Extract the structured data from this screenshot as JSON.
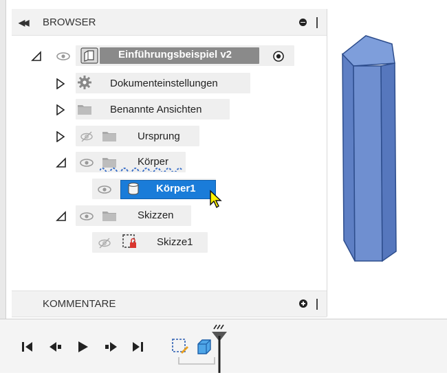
{
  "browser": {
    "title": "BROWSER",
    "collapse_icon": "double-chevron-left-icon",
    "options_icon": "minus-circle-icon",
    "root": {
      "label": "Einführungsbeispiel v2"
    },
    "items": [
      {
        "label": "Dokumenteinstellungen",
        "icon": "gear-icon"
      },
      {
        "label": "Benannte Ansichten",
        "icon": "folder-icon"
      },
      {
        "label": "Ursprung",
        "icon": "folder-icon"
      },
      {
        "label": "Körper",
        "icon": "folder-icon"
      },
      {
        "label": "Körper1",
        "icon": "body-icon",
        "selected": true
      },
      {
        "label": "Skizzen",
        "icon": "folder-icon"
      },
      {
        "label": "Skizze1",
        "icon": "sketch-icon"
      }
    ]
  },
  "comments": {
    "title": "KOMMENTARE"
  },
  "timeline": {
    "buttons": [
      "skip-to-start",
      "step-back",
      "play",
      "step-forward",
      "skip-to-end"
    ]
  },
  "colors": {
    "selection": "#1a7cd9",
    "prism_front": "#6f8fd0",
    "prism_side": "#5677bd",
    "prism_top": "#7e9edb"
  }
}
